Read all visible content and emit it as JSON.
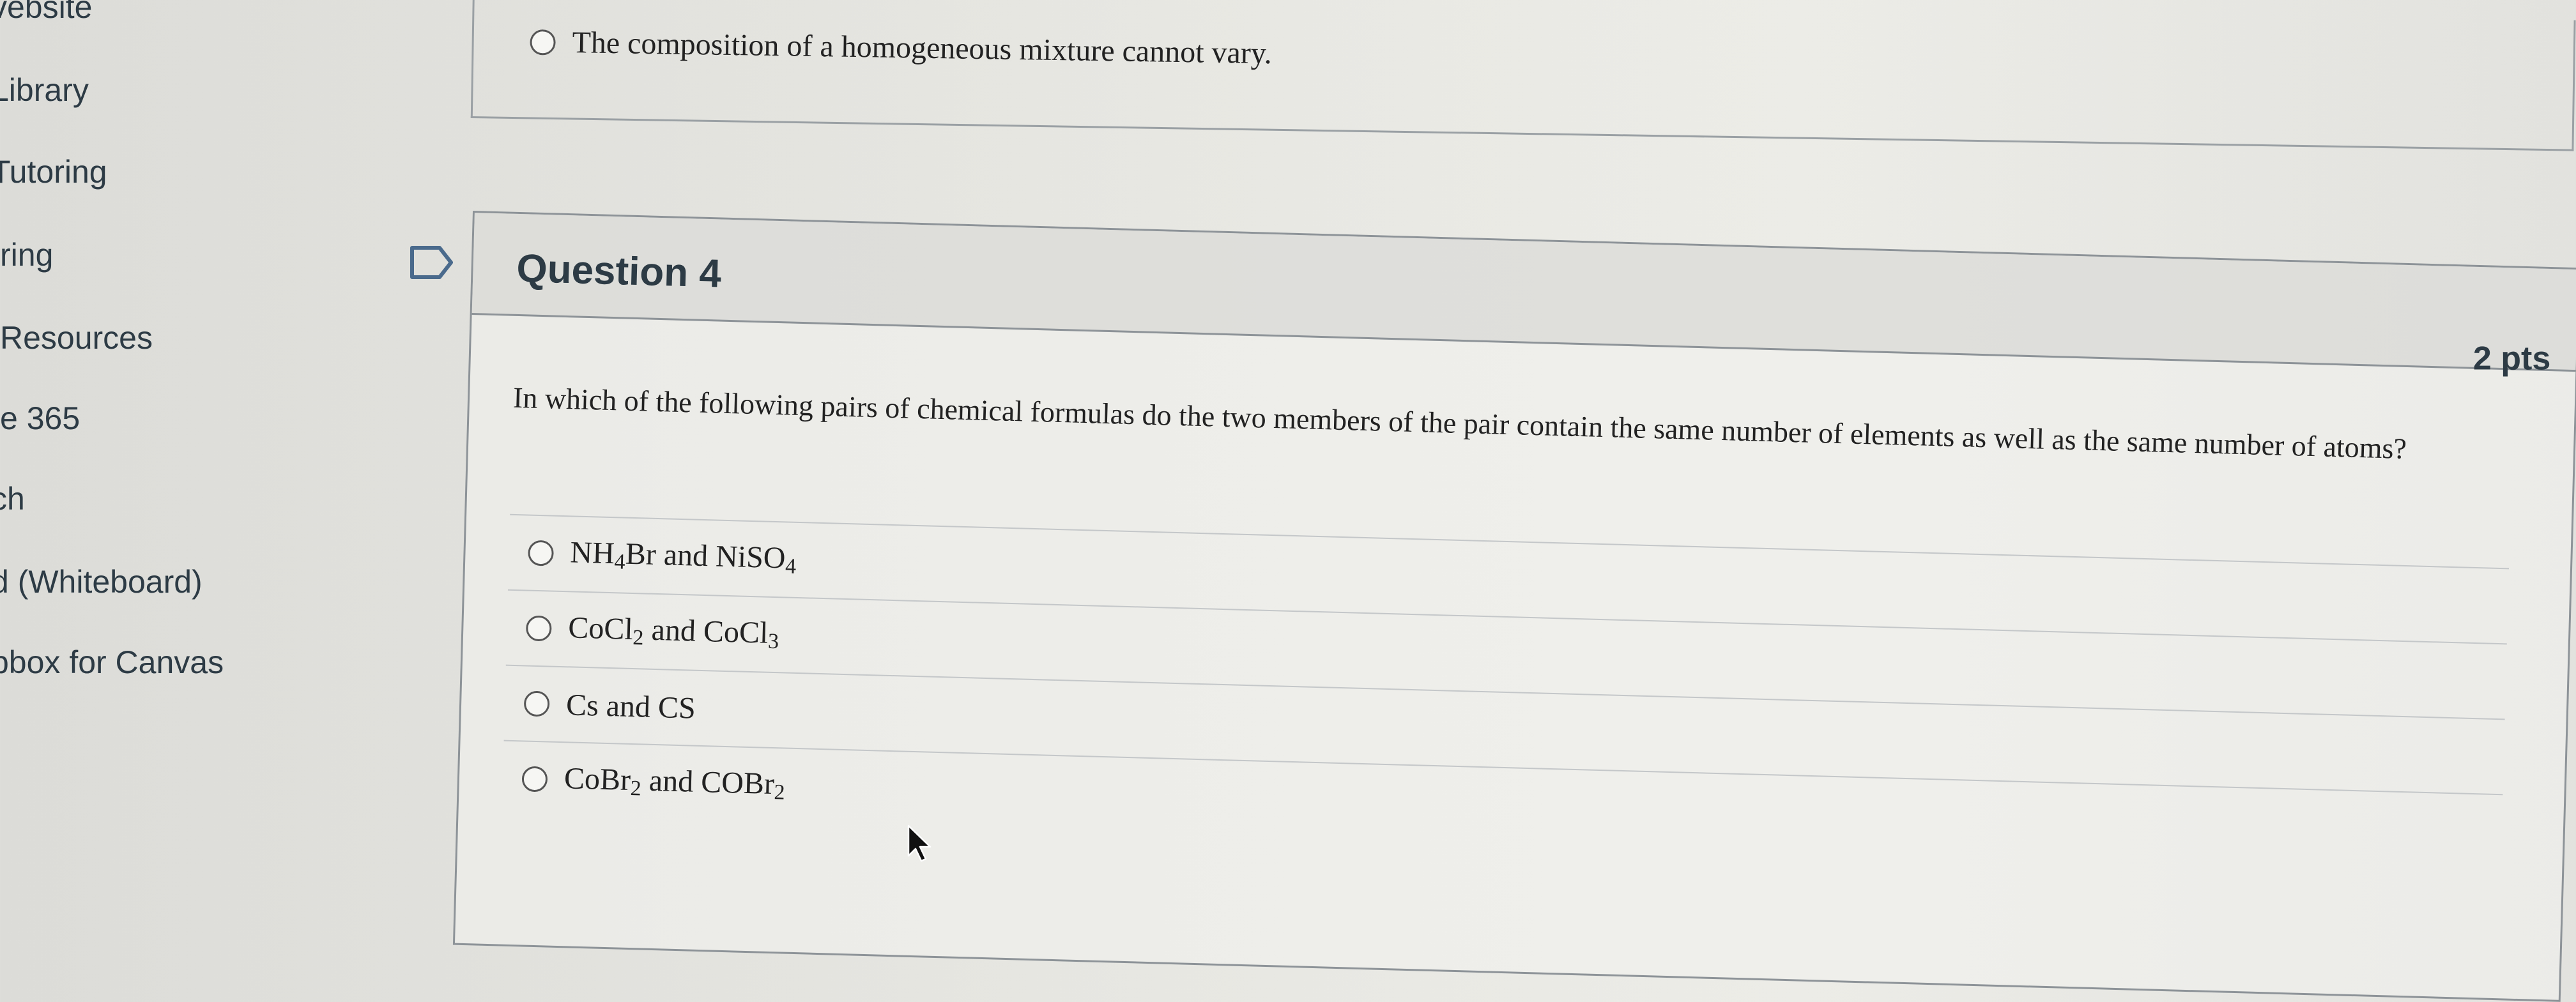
{
  "sidebar": {
    "items": [
      {
        "label": "vebsite"
      },
      {
        "label": "Library"
      },
      {
        "label": "Tutoring"
      },
      {
        "label": "ring"
      },
      {
        "label": "Resources"
      },
      {
        "label": "e 365"
      },
      {
        "label": "ch"
      },
      {
        "label": "d (Whiteboard)"
      },
      {
        "label": "pbox for Canvas"
      }
    ]
  },
  "previous_question": {
    "answer_text": "The composition of a homogeneous mixture cannot vary."
  },
  "question": {
    "title": "Question 4",
    "points": "2 pts",
    "text": "In which of the following pairs of chemical formulas do the two members of the pair contain the same number of elements as well as the same number of atoms?",
    "answers": [
      {
        "parts": [
          {
            "t": "NH"
          },
          {
            "s": "4"
          },
          {
            "t": "Br and NiSO"
          },
          {
            "s": "4"
          }
        ]
      },
      {
        "parts": [
          {
            "t": "CoCl"
          },
          {
            "s": "2"
          },
          {
            "t": " and CoCl"
          },
          {
            "s": "3"
          }
        ]
      },
      {
        "parts": [
          {
            "t": "Cs and CS"
          }
        ]
      },
      {
        "parts": [
          {
            "t": "CoBr"
          },
          {
            "s": "2"
          },
          {
            "t": " and COBr"
          },
          {
            "s": "2"
          }
        ]
      }
    ]
  },
  "icons": {
    "flag": "bookmark-flag-icon",
    "radio": "radio-button-icon",
    "cursor": "mouse-pointer-icon"
  },
  "colors": {
    "text": "#2d3b45",
    "border": "#8d9398",
    "header_bg": "#d2d2cd"
  }
}
